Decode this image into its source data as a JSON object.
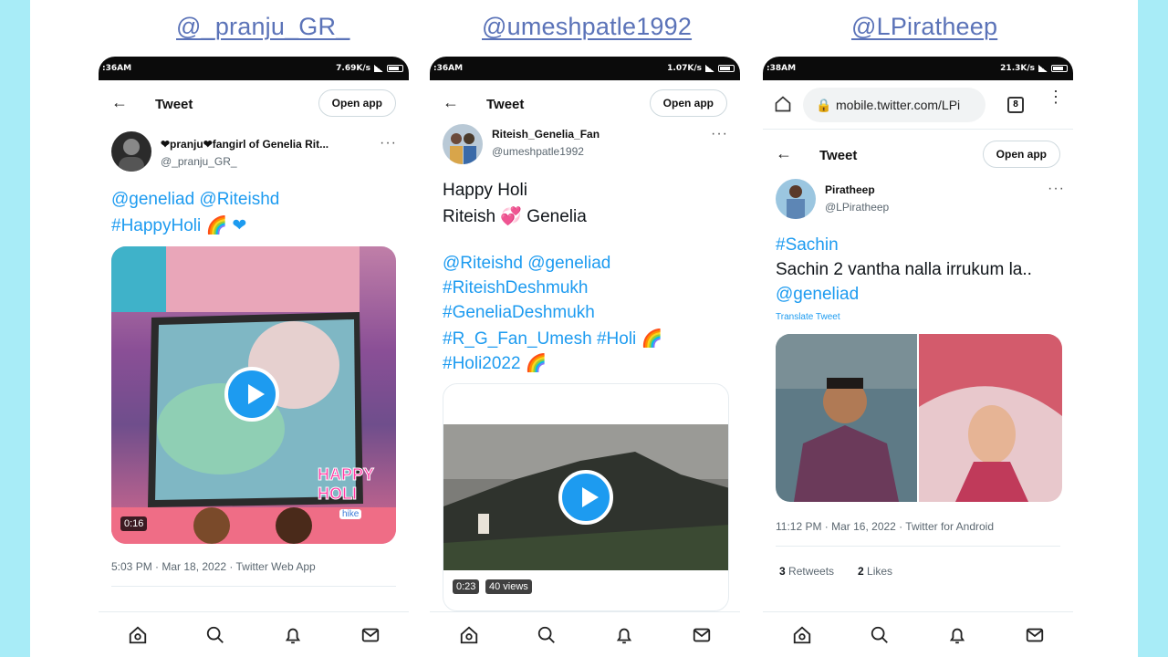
{
  "headers": [
    "@_pranju_GR_",
    "@umeshpatle1992",
    "@LPiratheep"
  ],
  "colors": {
    "accent": "#1d9bf0",
    "handle": "#5b73b8",
    "side_bg": "#a8ecf7"
  },
  "phone1": {
    "status_time": ":36AM",
    "status_right": "7.69K/s",
    "header_title": "Tweet",
    "open_app": "Open app",
    "user_name": "❤pranju❤fangirl of Genelia Rit...",
    "user_handle": "@_pranju_GR_",
    "text_line1": "@geneliad @Riteishd",
    "text_line2": "#HappyHoli 🌈 ❤",
    "video_duration": "0:16",
    "sticker_text": "HAPPY HOLI",
    "sticker_sub": "hike",
    "meta": "5:03 PM · Mar 18, 2022 · Twitter Web App"
  },
  "phone2": {
    "status_time": ":36AM",
    "status_right": "1.07K/s",
    "header_title": "Tweet",
    "open_app": "Open app",
    "user_name": "Riteish_Genelia_Fan",
    "user_handle": "@umeshpatle1992",
    "text_line1": "Happy Holi",
    "text_line2": "Riteish 💞 Genelia",
    "text_line3": "@Riteishd @geneliad",
    "text_line4": "#RiteishDeshmukh",
    "text_line5": "#GeneliaDeshmukh",
    "text_line6": "#R_G_Fan_Umesh #Holi 🌈",
    "text_line7": "#Holi2022 🌈",
    "video_duration": "0:23",
    "video_views": "40 views"
  },
  "phone3": {
    "status_time": ":38AM",
    "status_right": "21.3K/s",
    "url": "mobile.twitter.com/LPi",
    "tab_count": "8",
    "header_title": "Tweet",
    "open_app": "Open app",
    "user_name": "Piratheep",
    "user_handle": "@LPiratheep",
    "text_line1": "#Sachin",
    "text_line2": "Sachin 2 vantha nalla irrukum la..",
    "text_line3": "@geneliad",
    "translate": "Translate Tweet",
    "meta": "11:12 PM · Mar 16, 2022 · Twitter for Android",
    "retweets_count": "3",
    "retweets_label": "Retweets",
    "likes_count": "2",
    "likes_label": "Likes"
  },
  "icons": [
    "home-icon",
    "search-icon",
    "bell-icon",
    "mail-icon"
  ]
}
